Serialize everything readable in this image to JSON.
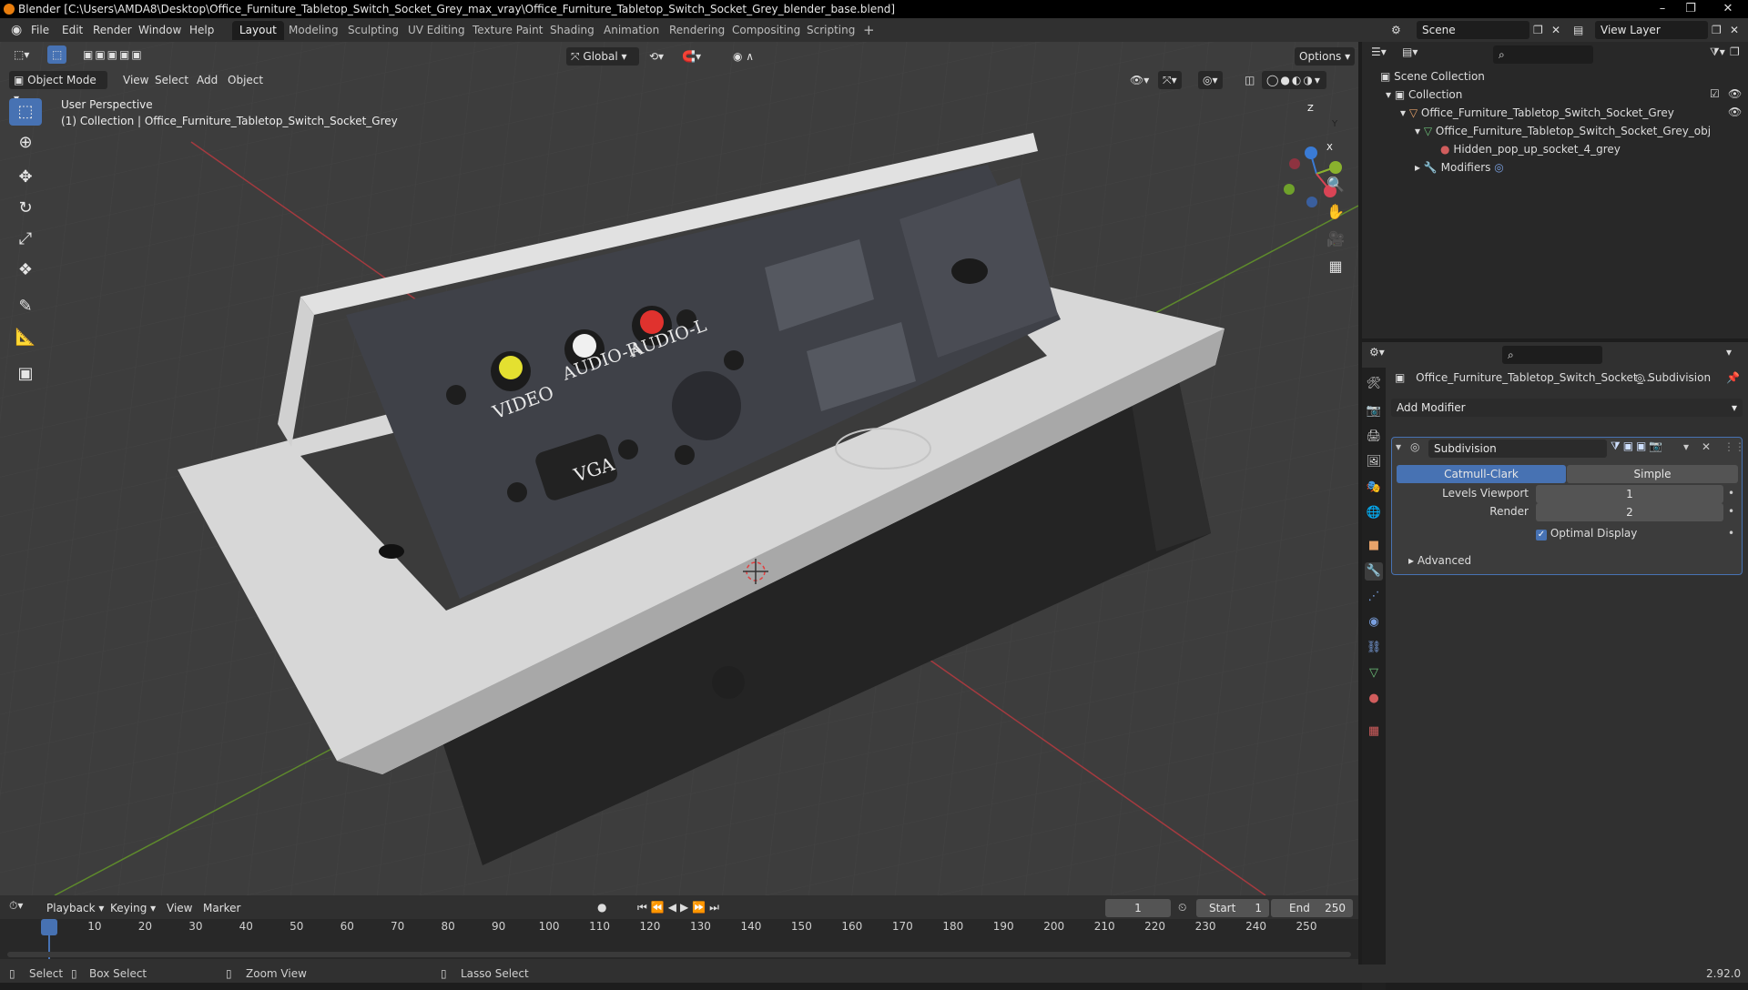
{
  "window": {
    "title": "Blender [C:\\Users\\AMDA8\\Desktop\\Office_Furniture_Tabletop_Switch_Socket_Grey_max_vray\\Office_Furniture_Tabletop_Switch_Socket_Grey_blender_base.blend]",
    "version": "2.92.0"
  },
  "menu": [
    "File",
    "Edit",
    "Render",
    "Window",
    "Help"
  ],
  "workspaces": [
    "Layout",
    "Modeling",
    "Sculpting",
    "UV Editing",
    "Texture Paint",
    "Shading",
    "Animation",
    "Rendering",
    "Compositing",
    "Scripting"
  ],
  "active_workspace": "Layout",
  "scene": {
    "name": "Scene",
    "view_layer": "View Layer"
  },
  "viewport": {
    "mode": "Object Mode",
    "menus": [
      "View",
      "Select",
      "Add",
      "Object"
    ],
    "transform_orientation": "Global",
    "options_label": "Options",
    "perspective_label": "User Perspective",
    "collection_label": "(1) Collection | Office_Furniture_Tabletop_Switch_Socket_Grey",
    "panel_labels": {
      "video": "VIDEO",
      "audio_r": "AUDIO-R",
      "audio_l": "AUDIO-L",
      "vga": "VGA"
    },
    "axes": {
      "x": "X",
      "y": "Y",
      "z": "Z"
    }
  },
  "outliner": {
    "root": "Scene Collection",
    "collection": "Collection",
    "object": "Office_Furniture_Tabletop_Switch_Socket_Grey",
    "mesh": "Office_Furniture_Tabletop_Switch_Socket_Grey_obj",
    "material": "Hidden_pop_up_socket_4_grey",
    "modifiers": "Modifiers"
  },
  "properties": {
    "object_name": "Office_Furniture_Tabletop_Switch_Socket_...",
    "modifier_breadcrumb": "Subdivision",
    "add_modifier": "Add Modifier",
    "modifier": {
      "name": "Subdivision",
      "type_options": [
        "Catmull-Clark",
        "Simple"
      ],
      "active_type": "Catmull-Clark",
      "levels_viewport_label": "Levels Viewport",
      "levels_viewport": "1",
      "render_label": "Render",
      "render_levels": "2",
      "optimal_display_label": "Optimal Display",
      "optimal_display": true,
      "advanced_label": "Advanced"
    }
  },
  "timeline": {
    "menus": [
      "Playback",
      "Keying",
      "View",
      "Marker"
    ],
    "current_frame": "1",
    "start_label": "Start",
    "start": "1",
    "end_label": "End",
    "end": "250",
    "ruler": [
      "1",
      "10",
      "20",
      "30",
      "40",
      "50",
      "60",
      "70",
      "80",
      "90",
      "100",
      "110",
      "120",
      "130",
      "140",
      "150",
      "160",
      "170",
      "180",
      "190",
      "200",
      "210",
      "220",
      "230",
      "240",
      "250"
    ]
  },
  "status": {
    "select": "Select",
    "box_select": "Box Select",
    "zoom_view": "Zoom View",
    "lasso_select": "Lasso Select"
  },
  "colors": {
    "accent": "#4772b3",
    "viewport_bg": "#3d3d3d",
    "x_axis": "#b8333a",
    "y_axis": "#6a9d2e"
  }
}
